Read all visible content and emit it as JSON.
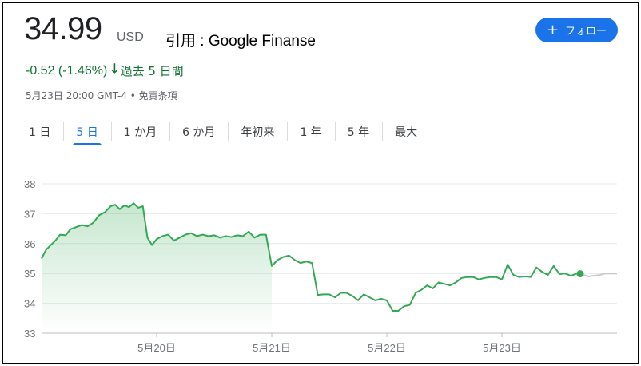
{
  "header": {
    "price": "34.99",
    "currency": "USD",
    "source_note": "引用 : Google Finanse",
    "follow_label": "フォロー"
  },
  "change": {
    "value": "-0.52 (-1.46%)",
    "period": "過去 5 日間",
    "direction": "down"
  },
  "timestamp": "5月23日 20:00 GMT-4 • 免責条項",
  "tabs": [
    {
      "label": "1 日",
      "active": false
    },
    {
      "label": "5 日",
      "active": true
    },
    {
      "label": "1 か月",
      "active": false
    },
    {
      "label": "6 か月",
      "active": false
    },
    {
      "label": "年初来",
      "active": false
    },
    {
      "label": "1 年",
      "active": false
    },
    {
      "label": "5 年",
      "active": false
    },
    {
      "label": "最大",
      "active": false
    }
  ],
  "colors": {
    "accent": "#1a73e8",
    "positive_line": "#34a853",
    "change_text": "#137333",
    "after_hours_line": "#c8c8c8"
  },
  "chart_data": {
    "type": "line",
    "ylim": [
      33,
      38
    ],
    "yticks": [
      33,
      34,
      35,
      36,
      37,
      38
    ],
    "xlim": [
      0,
      5
    ],
    "xticks": [
      {
        "x": 1,
        "label": "5月20日"
      },
      {
        "x": 2,
        "label": "5月21日"
      },
      {
        "x": 3,
        "label": "5月22日"
      },
      {
        "x": 4,
        "label": "5月23日"
      }
    ],
    "grid": true,
    "series": [
      {
        "values": [
          [
            0.0,
            35.5
          ],
          [
            0.04,
            35.8
          ],
          [
            0.08,
            35.95
          ],
          [
            0.12,
            36.1
          ],
          [
            0.16,
            36.3
          ],
          [
            0.21,
            36.28
          ],
          [
            0.25,
            36.48
          ],
          [
            0.3,
            36.55
          ],
          [
            0.35,
            36.62
          ],
          [
            0.4,
            36.58
          ],
          [
            0.45,
            36.7
          ],
          [
            0.5,
            36.95
          ],
          [
            0.55,
            37.05
          ],
          [
            0.6,
            37.25
          ],
          [
            0.64,
            37.3
          ],
          [
            0.68,
            37.15
          ],
          [
            0.72,
            37.28
          ],
          [
            0.76,
            37.22
          ],
          [
            0.8,
            37.35
          ],
          [
            0.84,
            37.2
          ],
          [
            0.88,
            37.25
          ],
          [
            0.92,
            36.2
          ],
          [
            0.96,
            35.95
          ],
          [
            1.0,
            36.15
          ],
          [
            1.05,
            36.25
          ],
          [
            1.1,
            36.3
          ],
          [
            1.15,
            36.1
          ],
          [
            1.2,
            36.2
          ],
          [
            1.25,
            36.3
          ],
          [
            1.3,
            36.35
          ],
          [
            1.35,
            36.25
          ],
          [
            1.4,
            36.3
          ],
          [
            1.45,
            36.25
          ],
          [
            1.5,
            36.28
          ],
          [
            1.55,
            36.2
          ],
          [
            1.6,
            36.25
          ],
          [
            1.65,
            36.22
          ],
          [
            1.7,
            36.28
          ],
          [
            1.75,
            36.25
          ],
          [
            1.8,
            36.4
          ],
          [
            1.85,
            36.2
          ],
          [
            1.9,
            36.3
          ],
          [
            1.95,
            36.3
          ],
          [
            2.0,
            35.25
          ],
          [
            2.05,
            35.45
          ],
          [
            2.1,
            35.55
          ],
          [
            2.15,
            35.6
          ],
          [
            2.2,
            35.45
          ],
          [
            2.25,
            35.35
          ],
          [
            2.3,
            35.4
          ],
          [
            2.35,
            35.35
          ],
          [
            2.4,
            34.28
          ],
          [
            2.45,
            34.3
          ],
          [
            2.5,
            34.3
          ],
          [
            2.55,
            34.2
          ],
          [
            2.6,
            34.35
          ],
          [
            2.65,
            34.35
          ],
          [
            2.7,
            34.25
          ],
          [
            2.75,
            34.1
          ],
          [
            2.8,
            34.3
          ],
          [
            2.85,
            34.2
          ],
          [
            2.9,
            34.1
          ],
          [
            2.95,
            34.15
          ],
          [
            3.0,
            34.1
          ],
          [
            3.05,
            33.75
          ],
          [
            3.1,
            33.75
          ],
          [
            3.15,
            33.9
          ],
          [
            3.2,
            33.95
          ],
          [
            3.25,
            34.35
          ],
          [
            3.3,
            34.45
          ],
          [
            3.35,
            34.6
          ],
          [
            3.4,
            34.5
          ],
          [
            3.45,
            34.7
          ],
          [
            3.5,
            34.65
          ],
          [
            3.55,
            34.6
          ],
          [
            3.6,
            34.7
          ],
          [
            3.65,
            34.85
          ],
          [
            3.7,
            34.88
          ],
          [
            3.75,
            34.88
          ],
          [
            3.8,
            34.8
          ],
          [
            3.85,
            34.85
          ],
          [
            3.9,
            34.88
          ],
          [
            3.95,
            34.88
          ],
          [
            4.0,
            34.8
          ],
          [
            4.05,
            35.3
          ],
          [
            4.1,
            34.95
          ],
          [
            4.15,
            34.88
          ],
          [
            4.2,
            34.9
          ],
          [
            4.25,
            34.88
          ],
          [
            4.3,
            35.2
          ],
          [
            4.35,
            35.05
          ],
          [
            4.4,
            34.95
          ],
          [
            4.45,
            35.25
          ],
          [
            4.5,
            34.98
          ],
          [
            4.55,
            35.0
          ],
          [
            4.6,
            34.92
          ],
          [
            4.65,
            35.0
          ],
          [
            4.68,
            34.99
          ]
        ]
      },
      {
        "values": [
          [
            4.68,
            34.99
          ],
          [
            4.75,
            34.9
          ],
          [
            4.85,
            34.95
          ],
          [
            4.9,
            35.0
          ],
          [
            5.0,
            35.0
          ]
        ]
      }
    ]
  }
}
